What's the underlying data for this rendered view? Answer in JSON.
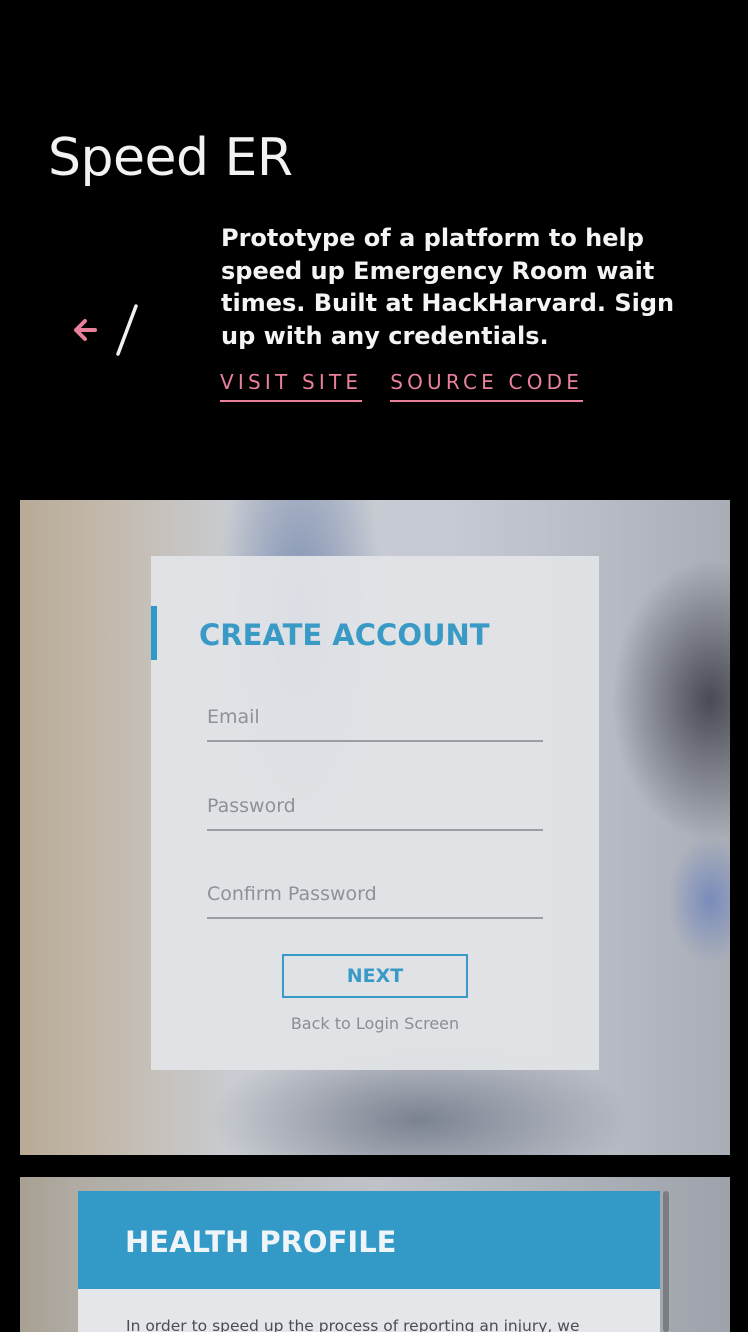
{
  "project": {
    "title": "Speed ER",
    "description": "Prototype of a platform to help speed up Emergency Room wait times. Built at HackHarvard. Sign up with any credentials.",
    "links": {
      "visit_site": "VISIT SITE",
      "source_code": "SOURCE CODE"
    },
    "nav": {
      "back_icon": "arrow-left-icon",
      "separator": "/"
    }
  },
  "colors": {
    "accent_pink": "#e9809a",
    "brand_blue": "#3399c6",
    "background": "#000000"
  },
  "screenshot_1": {
    "card_title": "CREATE ACCOUNT",
    "fields": {
      "email_placeholder": "Email",
      "password_placeholder": "Password",
      "confirm_placeholder": "Confirm Password"
    },
    "next_label": "NEXT",
    "back_link": "Back to Login Screen"
  },
  "screenshot_2": {
    "title": "HEALTH PROFILE",
    "text": "In order to speed up the process of reporting an injury, we"
  }
}
